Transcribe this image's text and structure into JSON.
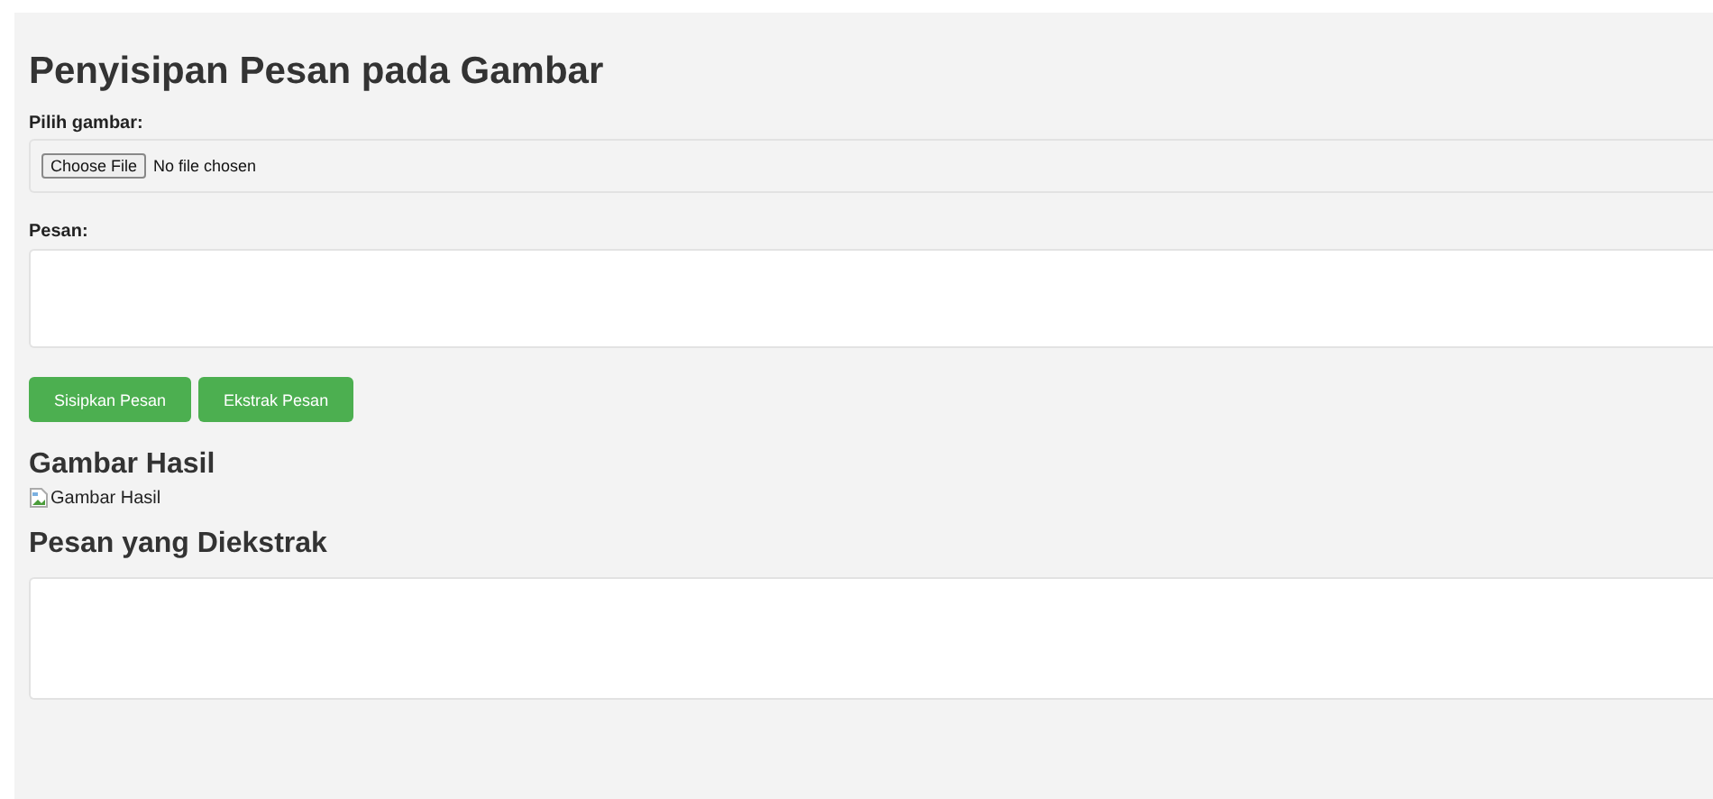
{
  "title": "Penyisipan Pesan pada Gambar",
  "image_input": {
    "label": "Pilih gambar:",
    "button": "Choose File",
    "status": "No file chosen"
  },
  "message_input": {
    "label": "Pesan:"
  },
  "buttons": [
    "Sisipkan Pesan",
    "Ekstrak Pesan"
  ],
  "result": {
    "heading": "Gambar Hasil",
    "image_alt": "Gambar Hasil"
  },
  "extracted": {
    "heading": "Pesan yang Diekstrak"
  }
}
